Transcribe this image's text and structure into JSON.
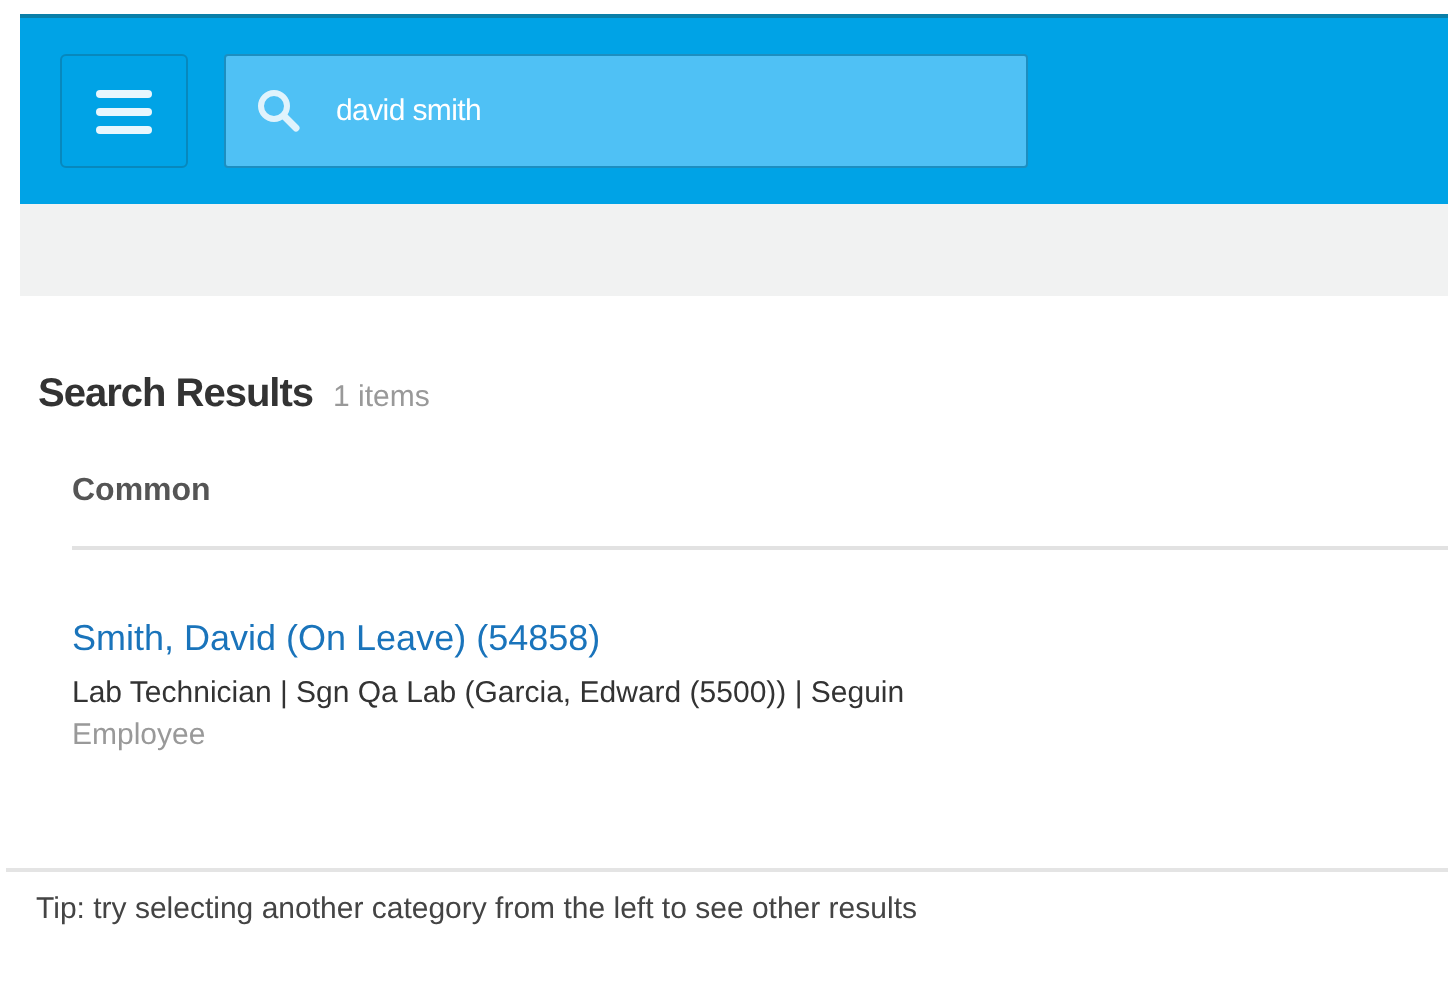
{
  "search": {
    "value": "david smith"
  },
  "results": {
    "title": "Search Results",
    "count": "1 items",
    "category": "Common",
    "items": [
      {
        "name": "Smith, David (On Leave) (54858)",
        "details": "Lab Technician | Sgn Qa Lab (Garcia, Edward (5500)) | Seguin",
        "type": "Employee"
      }
    ]
  },
  "tip": "Tip: try selecting another category from the left to see other results"
}
